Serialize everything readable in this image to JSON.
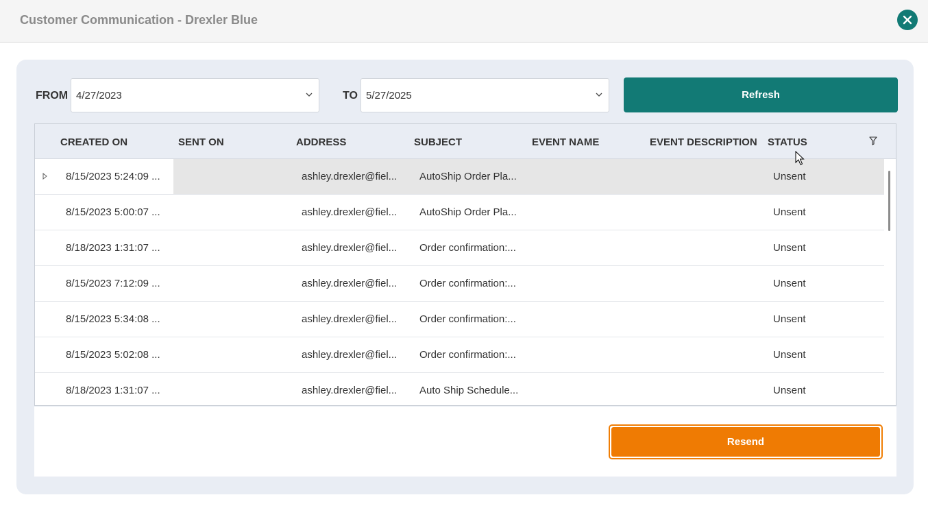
{
  "window": {
    "title": "Customer Communication - Drexler Blue",
    "close_icon": "close-icon",
    "accent_color": "#127a75"
  },
  "filters": {
    "from_label": "FROM",
    "from_value": "4/27/2023",
    "to_label": "TO",
    "to_value": "5/27/2025",
    "refresh_label": "Refresh"
  },
  "grid": {
    "columns": [
      "CREATED ON",
      "SENT ON",
      "ADDRESS",
      "SUBJECT",
      "EVENT NAME",
      "EVENT DESCRIPTION",
      "STATUS"
    ],
    "filter_icon": "filter-icon",
    "rows": [
      {
        "created_on": "8/15/2023 5:24:09 ...",
        "sent_on": "",
        "address": "ashley.drexler@fiel...",
        "subject": "AutoShip Order Pla...",
        "event_name": "",
        "event_description": "",
        "status": "Unsent"
      },
      {
        "created_on": "8/15/2023 5:00:07 ...",
        "sent_on": "",
        "address": "ashley.drexler@fiel...",
        "subject": "AutoShip Order Pla...",
        "event_name": "",
        "event_description": "",
        "status": "Unsent"
      },
      {
        "created_on": "8/18/2023 1:31:07 ...",
        "sent_on": "",
        "address": "ashley.drexler@fiel...",
        "subject": "Order confirmation:...",
        "event_name": "",
        "event_description": "",
        "status": "Unsent"
      },
      {
        "created_on": "8/15/2023 7:12:09 ...",
        "sent_on": "",
        "address": "ashley.drexler@fiel...",
        "subject": "Order confirmation:...",
        "event_name": "",
        "event_description": "",
        "status": "Unsent"
      },
      {
        "created_on": "8/15/2023 5:34:08 ...",
        "sent_on": "",
        "address": "ashley.drexler@fiel...",
        "subject": "Order confirmation:...",
        "event_name": "",
        "event_description": "",
        "status": "Unsent"
      },
      {
        "created_on": "8/15/2023 5:02:08 ...",
        "sent_on": "",
        "address": "ashley.drexler@fiel...",
        "subject": "Order confirmation:...",
        "event_name": "",
        "event_description": "",
        "status": "Unsent"
      },
      {
        "created_on": "8/18/2023 1:31:07 ...",
        "sent_on": "",
        "address": "ashley.drexler@fiel...",
        "subject": "Auto Ship Schedule...",
        "event_name": "",
        "event_description": "",
        "status": "Unsent"
      }
    ]
  },
  "actions": {
    "resend_label": "Resend",
    "resend_color": "#ef7b03"
  }
}
